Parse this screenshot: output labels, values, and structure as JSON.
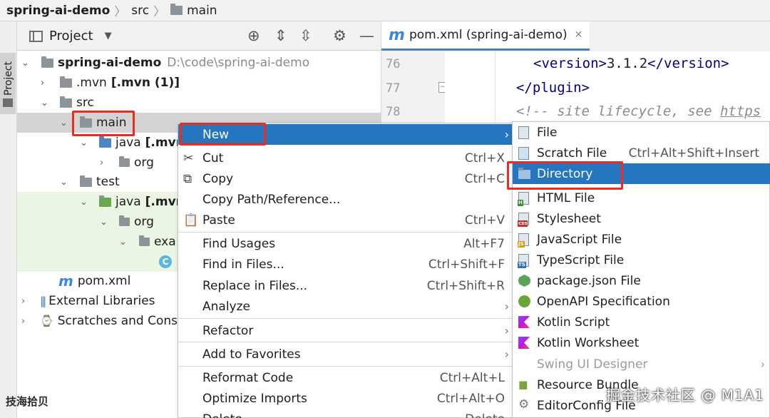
{
  "breadcrumb": [
    "spring-ai-demo",
    "src",
    "main"
  ],
  "side_stripe": {
    "label": "Project"
  },
  "project_panel": {
    "title": "Project",
    "tree": [
      {
        "label": "spring-ai-demo",
        "path": "D:\\code\\spring-ai-demo"
      },
      {
        "label": ".mvn",
        "module": "[.mvn (1)]"
      },
      {
        "label": "src"
      },
      {
        "label": "main"
      },
      {
        "label": "java",
        "module": "[.mvn"
      },
      {
        "label": "org"
      },
      {
        "label": "test"
      },
      {
        "label": "java",
        "module": "[.mvn"
      },
      {
        "label": "org"
      },
      {
        "label": "exa"
      },
      {
        "label": "C"
      },
      {
        "label": "pom.xml"
      },
      {
        "label": "External Libraries"
      },
      {
        "label": "Scratches and Conso"
      }
    ]
  },
  "editor": {
    "tab_label": "pom.xml (spring-ai-demo)",
    "tab_close": "✕",
    "line_numbers": [
      "76",
      "77",
      "78"
    ],
    "lines": [
      {
        "open": "<version>",
        "text": "3.1.2",
        "close": "</version>"
      },
      {
        "tag": "</plugin>"
      },
      {
        "comment": "<!-- site lifecycle, see ",
        "link": "https"
      }
    ]
  },
  "context_menu": {
    "items": [
      {
        "label": "New",
        "shortcut": "",
        "icon": ""
      },
      {
        "label": "Cut",
        "shortcut": "Ctrl+X",
        "icon": "scissors-icon"
      },
      {
        "label": "Copy",
        "shortcut": "Ctrl+C",
        "icon": "copy-icon"
      },
      {
        "label": "Copy Path/Reference...",
        "shortcut": ""
      },
      {
        "label": "Paste",
        "shortcut": "Ctrl+V",
        "icon": "paste-icon"
      },
      {
        "label": "Find Usages",
        "shortcut": "Alt+F7"
      },
      {
        "label": "Find in Files...",
        "shortcut": "Ctrl+Shift+F"
      },
      {
        "label": "Replace in Files...",
        "shortcut": "Ctrl+Shift+R"
      },
      {
        "label": "Analyze",
        "shortcut": ""
      },
      {
        "label": "Refactor",
        "shortcut": ""
      },
      {
        "label": "Add to Favorites",
        "shortcut": ""
      },
      {
        "label": "Reformat Code",
        "shortcut": "Ctrl+Alt+L"
      },
      {
        "label": "Optimize Imports",
        "shortcut": "Ctrl+Alt+O"
      },
      {
        "label": "Delete",
        "shortcut": "Delete"
      }
    ]
  },
  "new_submenu": {
    "items": [
      {
        "label": "File",
        "shortcut": ""
      },
      {
        "label": "Scratch File",
        "shortcut": "Ctrl+Alt+Shift+Insert"
      },
      {
        "label": "Directory",
        "shortcut": ""
      },
      {
        "label": "HTML File",
        "shortcut": ""
      },
      {
        "label": "Stylesheet",
        "shortcut": ""
      },
      {
        "label": "JavaScript File",
        "shortcut": ""
      },
      {
        "label": "TypeScript File",
        "shortcut": ""
      },
      {
        "label": "package.json File",
        "shortcut": ""
      },
      {
        "label": "OpenAPI Specification",
        "shortcut": ""
      },
      {
        "label": "Kotlin Script",
        "shortcut": ""
      },
      {
        "label": "Kotlin Worksheet",
        "shortcut": ""
      },
      {
        "label": "Swing UI Designer",
        "shortcut": ""
      },
      {
        "label": "Resource Bundle",
        "shortcut": ""
      },
      {
        "label": "EditorConfig File",
        "shortcut": ""
      }
    ],
    "icon_badges": {
      "html": "H",
      "css": "css",
      "js": "JS",
      "ts": "TS"
    }
  },
  "watermarks": {
    "left": "技海拾贝",
    "right": "掘金技术社区 @ M1A1"
  },
  "colors": {
    "selection": "#2675bf",
    "highlight_box": "#ee2c1e",
    "maven_blue": "#3d87d6",
    "source_folder": "#4b87c6"
  }
}
